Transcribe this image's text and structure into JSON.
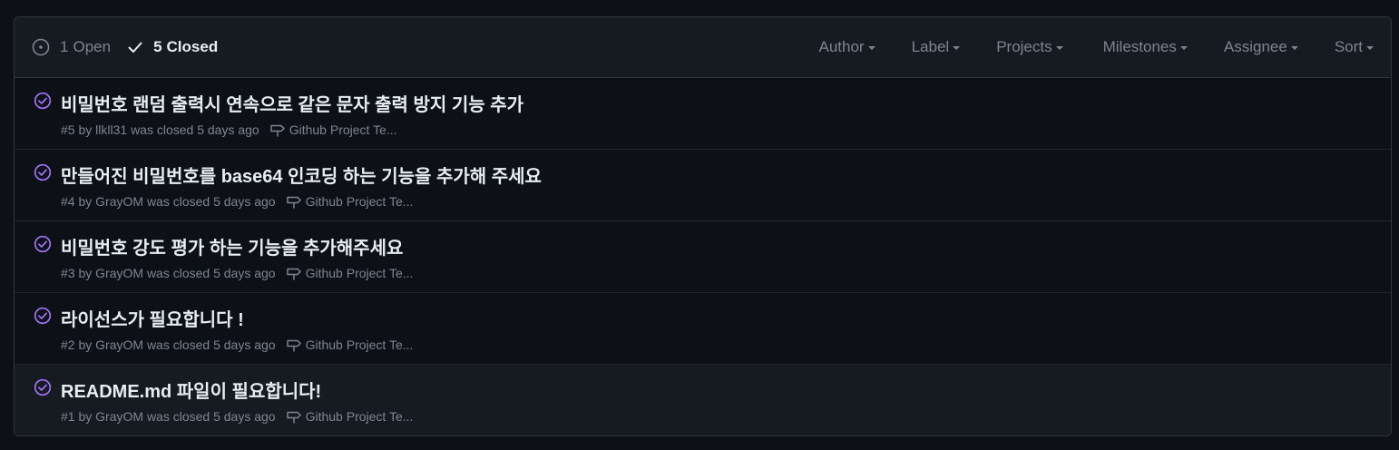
{
  "header": {
    "open_count": "1",
    "open_label": "Open",
    "closed_count": "5",
    "closed_label": "Closed",
    "filters": {
      "author": "Author",
      "label": "Label",
      "projects": "Projects",
      "milestones": "Milestones",
      "assignee": "Assignee",
      "sort": "Sort"
    }
  },
  "issues": [
    {
      "title": "비밀번호 랜덤 출력시 연속으로 같은 문자 출력 방지 기능 추가",
      "number": "#5",
      "by": "by",
      "author": "llkll31",
      "status_text": "was closed",
      "time": "5 days ago",
      "milestone": "Github Project Te..."
    },
    {
      "title": "만들어진 비밀번호를 base64 인코딩 하는 기능을 추가해 주세요",
      "number": "#4",
      "by": "by",
      "author": "GrayOM",
      "status_text": "was closed",
      "time": "5 days ago",
      "milestone": "Github Project Te..."
    },
    {
      "title": "비밀번호 강도 평가 하는 기능을 추가해주세요",
      "number": "#3",
      "by": "by",
      "author": "GrayOM",
      "status_text": "was closed",
      "time": "5 days ago",
      "milestone": "Github Project Te..."
    },
    {
      "title": "라이선스가 필요합니다 !",
      "number": "#2",
      "by": "by",
      "author": "GrayOM",
      "status_text": "was closed",
      "time": "5 days ago",
      "milestone": "Github Project Te..."
    },
    {
      "title": "README.md 파일이 필요합니다!",
      "number": "#1",
      "by": "by",
      "author": "GrayOM",
      "status_text": "was closed",
      "time": "5 days ago",
      "milestone": "Github Project Te..."
    }
  ],
  "colors": {
    "background": "#0d1117",
    "header_bg": "#161b22",
    "border": "#30363d",
    "closed_purple": "#a371f7",
    "muted": "#7d8590",
    "text": "#e6edf3"
  },
  "icons": {
    "open_state": "issue-opened-icon",
    "closed_state": "check-icon",
    "issue_closed": "issue-closed-icon",
    "milestone": "milestone-icon"
  }
}
